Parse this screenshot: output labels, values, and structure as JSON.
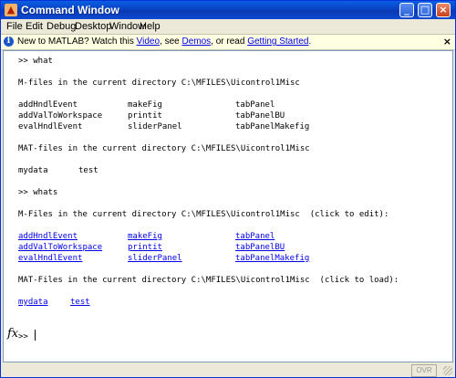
{
  "window": {
    "title": "Command Window"
  },
  "title_buttons": {
    "minimize": "_",
    "maximize": "□",
    "close": "×"
  },
  "menu": [
    "File",
    "Edit",
    "Debug",
    "Desktop",
    "Window",
    "Help"
  ],
  "notice": {
    "prefix": "New to MATLAB? Watch this ",
    "video": "Video",
    "mid1": ", see ",
    "demos": "Demos",
    "mid2": ", or read ",
    "getting_started": "Getting Started",
    "suffix": ".",
    "close": "×"
  },
  "console": {
    "cmd1": ">> what",
    "mfiles_header": "M-files in the current directory C:\\MFILES\\Uicontrol1Misc",
    "mfiles": [
      [
        "addHndlEvent",
        "makeFig",
        "tabPanel"
      ],
      [
        "addValToWorkspace",
        "printit",
        "tabPanelBU"
      ],
      [
        "evalHndlEvent",
        "sliderPanel",
        "tabPanelMakefig"
      ]
    ],
    "matfiles_header": "MAT-files in the current directory C:\\MFILES\\Uicontrol1Misc",
    "matfiles": [
      "mydata",
      "test"
    ],
    "cmd2": ">> whats",
    "mfiles_header2": "M-Files in the current directory C:\\MFILES\\Uicontrol1Misc  (click to edit):",
    "matfiles_header2": "MAT-Files in the current directory C:\\MFILES\\Uicontrol1Misc  (click to load):",
    "prompt": ">> "
  },
  "status": {
    "ovr": "OVR"
  }
}
